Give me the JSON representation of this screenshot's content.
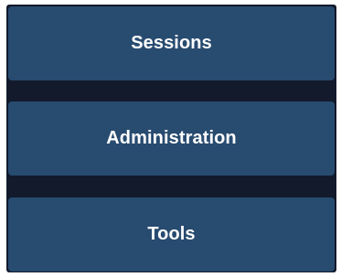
{
  "colors": {
    "panel_background": "#121a2b",
    "button_background": "#284b70",
    "button_text": "#ffffff"
  },
  "menu": {
    "items": [
      {
        "label": "Sessions"
      },
      {
        "label": "Administration"
      },
      {
        "label": "Tools"
      }
    ]
  }
}
